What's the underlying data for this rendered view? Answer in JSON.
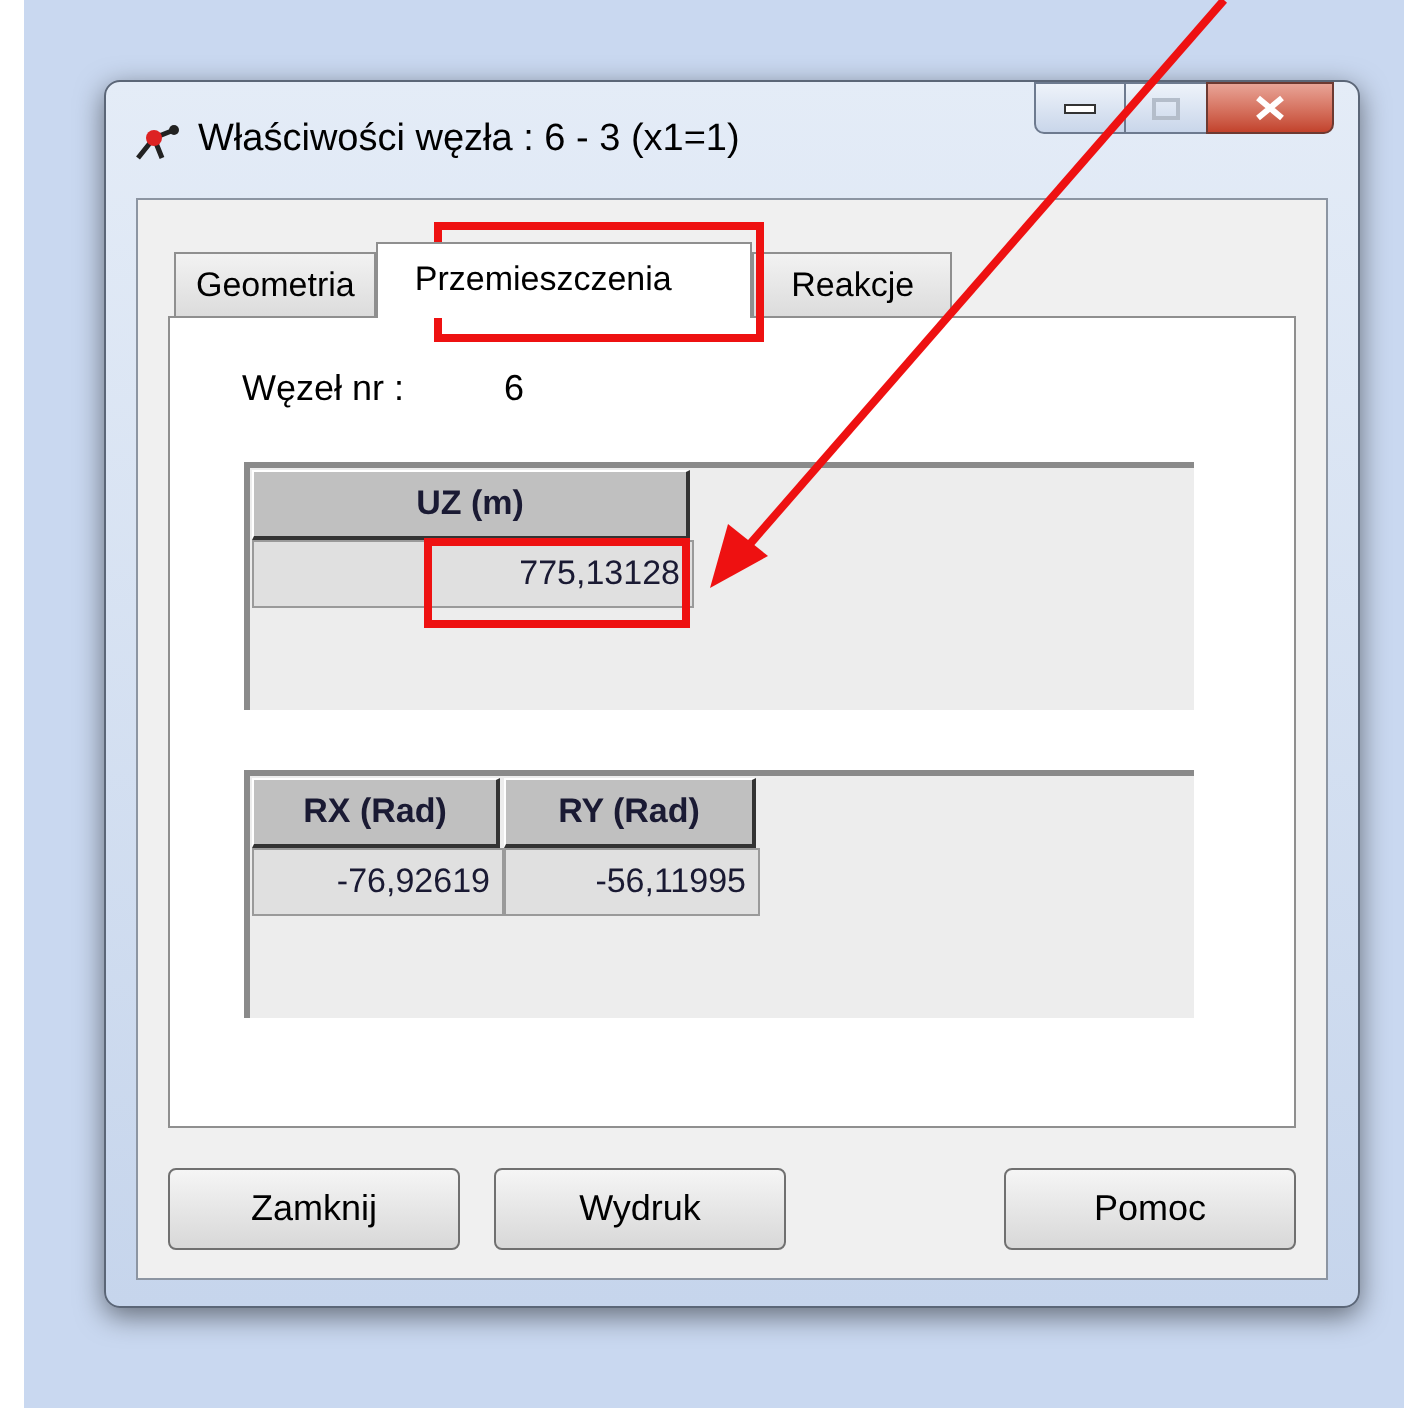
{
  "window": {
    "title": "Właściwości węzła : 6 - 3 (x1=1)"
  },
  "tabs": [
    {
      "label": "Geometria",
      "selected": false
    },
    {
      "label": "Przemieszczenia",
      "selected": true
    },
    {
      "label": "Reakcje",
      "selected": false
    }
  ],
  "node": {
    "label": "Węzeł nr :",
    "value": "6"
  },
  "tables": [
    {
      "columns": [
        "UZ (m)"
      ],
      "rows": [
        [
          "775,13128"
        ]
      ]
    },
    {
      "columns": [
        "RX (Rad)",
        "RY (Rad)"
      ],
      "rows": [
        [
          "-76,92619",
          "-56,11995"
        ]
      ]
    }
  ],
  "buttons": [
    "Zamknij",
    "Wydruk",
    "Pomoc"
  ]
}
